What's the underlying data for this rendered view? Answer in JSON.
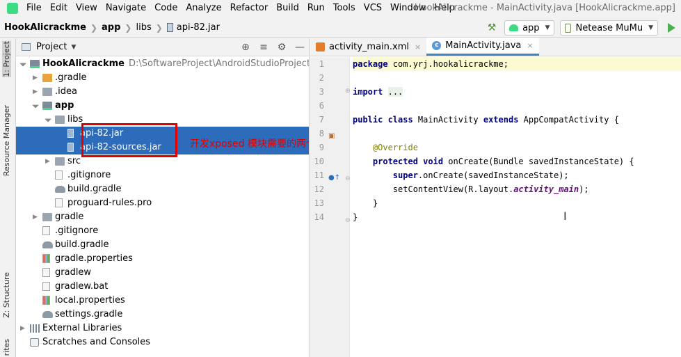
{
  "menu": [
    "File",
    "Edit",
    "View",
    "Navigate",
    "Code",
    "Analyze",
    "Refactor",
    "Build",
    "Run",
    "Tools",
    "VCS",
    "Window",
    "Help"
  ],
  "window_title": "HookAlicrackme - MainActivity.java [HookAlicrackme.app]",
  "breadcrumb": [
    "HookAlicrackme",
    "app",
    "libs",
    "api-82.jar"
  ],
  "toolbar": {
    "config": "app",
    "device": "Netease MuMu"
  },
  "left_tabs": [
    "1: Project",
    "Resource Manager",
    "Z: Structure",
    "rites"
  ],
  "project_panel": {
    "title": "Project"
  },
  "tree": [
    {
      "label": "HookAlicrackme",
      "path": "D:\\SoftwareProject\\AndroidStudioProjects\\Hook",
      "indent": 0,
      "arrow": "open",
      "icon": "folder-app",
      "bold": true
    },
    {
      "label": ".gradle",
      "indent": 1,
      "arrow": "closed",
      "icon": "folder-orange"
    },
    {
      "label": ".idea",
      "indent": 1,
      "arrow": "closed",
      "icon": "folder"
    },
    {
      "label": "app",
      "indent": 1,
      "arrow": "open",
      "icon": "folder-app",
      "bold": true
    },
    {
      "label": "libs",
      "indent": 2,
      "arrow": "open",
      "icon": "folder"
    },
    {
      "label": "api-82.jar",
      "indent": 3,
      "arrow": "",
      "icon": "jar",
      "selected": true
    },
    {
      "label": "api-82-sources.jar",
      "indent": 3,
      "arrow": "",
      "icon": "jar",
      "selected": true
    },
    {
      "label": "src",
      "indent": 2,
      "arrow": "closed",
      "icon": "folder"
    },
    {
      "label": ".gitignore",
      "indent": 2,
      "arrow": "",
      "icon": "file"
    },
    {
      "label": "build.gradle",
      "indent": 2,
      "arrow": "",
      "icon": "gradle"
    },
    {
      "label": "proguard-rules.pro",
      "indent": 2,
      "arrow": "",
      "icon": "file"
    },
    {
      "label": "gradle",
      "indent": 1,
      "arrow": "closed",
      "icon": "folder"
    },
    {
      "label": ".gitignore",
      "indent": 1,
      "arrow": "",
      "icon": "file"
    },
    {
      "label": "build.gradle",
      "indent": 1,
      "arrow": "",
      "icon": "gradle"
    },
    {
      "label": "gradle.properties",
      "indent": 1,
      "arrow": "",
      "icon": "bars"
    },
    {
      "label": "gradlew",
      "indent": 1,
      "arrow": "",
      "icon": "file"
    },
    {
      "label": "gradlew.bat",
      "indent": 1,
      "arrow": "",
      "icon": "file"
    },
    {
      "label": "local.properties",
      "indent": 1,
      "arrow": "",
      "icon": "bars"
    },
    {
      "label": "settings.gradle",
      "indent": 1,
      "arrow": "",
      "icon": "gradle"
    },
    {
      "label": "External Libraries",
      "indent": 0,
      "arrow": "closed",
      "icon": "lib"
    },
    {
      "label": "Scratches and Consoles",
      "indent": 0,
      "arrow": "",
      "icon": "scratch"
    }
  ],
  "annotation": "开发xposed 模块需要的两个jar包",
  "editor_tabs": [
    {
      "label": "activity_main.xml",
      "icon": "xml",
      "active": false
    },
    {
      "label": "MainActivity.java",
      "icon": "class",
      "active": true
    }
  ],
  "code_lines": [
    {
      "num": "1",
      "html": "<span class=\"kw\">package</span> com.yrj.hookalicrackme;",
      "hl": true
    },
    {
      "num": "2",
      "html": ""
    },
    {
      "num": "3",
      "html": "<span class=\"kw\">import</span> <span class=\"fold-dots\">...</span>"
    },
    {
      "num": "6",
      "html": ""
    },
    {
      "num": "7",
      "html": "<span class=\"kw\">public class</span> MainActivity <span class=\"kw\">extends</span> AppCompatActivity {"
    },
    {
      "num": "8",
      "html": ""
    },
    {
      "num": "9",
      "html": "    <span class=\"ann\">@Override</span>"
    },
    {
      "num": "10",
      "html": "    <span class=\"kw\">protected void</span> onCreate(Bundle savedInstanceState) {"
    },
    {
      "num": "11",
      "html": "        <span class=\"kw\">super</span>.onCreate(savedInstanceState);"
    },
    {
      "num": "12",
      "html": "        setContentView(R.layout.<span class=\"it\">activity_main</span>);"
    },
    {
      "num": "13",
      "html": "    }"
    },
    {
      "num": "14",
      "html": "}"
    }
  ]
}
